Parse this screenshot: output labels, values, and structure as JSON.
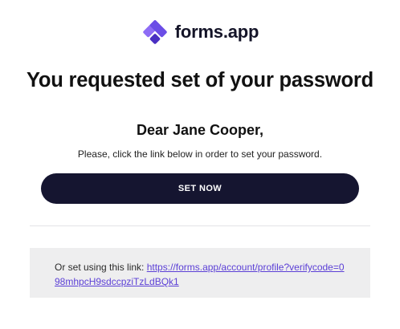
{
  "brand": {
    "name": "forms.app",
    "logo_icon": "forms-app-logo-icon",
    "logo_colors": [
      "#6B4DE6",
      "#8E6CF5",
      "#4A2FC2"
    ]
  },
  "email": {
    "headline": "You requested set of your password",
    "greeting": "Dear Jane Cooper,",
    "instruction": "Please, click the link below in order to set your password.",
    "button_label": "SET NOW",
    "alt_link_prefix": "Or set using this link:",
    "alt_link_url": "https://forms.app/account/profile?verifycode=098mhpcH9sdccpziTzLdBQk1"
  },
  "colors": {
    "button_bg": "#151530",
    "link": "#5B3FD6",
    "link_box_bg": "#EEEEEF"
  }
}
